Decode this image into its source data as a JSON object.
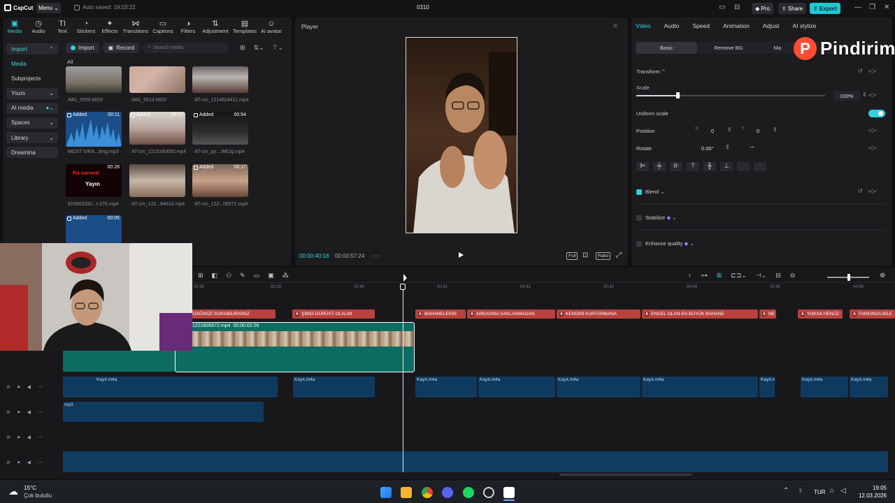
{
  "app": {
    "name": "CapCut",
    "menu_label": "Menu",
    "autosave": "Auto saved: 19:03:22",
    "project_title": "0310",
    "pro_label": "Pro",
    "share_label": "Share",
    "export_label": "Export"
  },
  "toolbar": {
    "items": [
      {
        "label": "Media",
        "icon": "media-icon"
      },
      {
        "label": "Audio",
        "icon": "audio-icon"
      },
      {
        "label": "Text",
        "icon": "text-icon"
      },
      {
        "label": "Stickers",
        "icon": "stickers-icon"
      },
      {
        "label": "Effects",
        "icon": "effects-icon"
      },
      {
        "label": "Transitions",
        "icon": "transitions-icon"
      },
      {
        "label": "Captions",
        "icon": "captions-icon"
      },
      {
        "label": "Filters",
        "icon": "filters-icon"
      },
      {
        "label": "Adjustment",
        "icon": "adjustment-icon"
      },
      {
        "label": "Templates",
        "icon": "templates-icon"
      },
      {
        "label": "AI avatar",
        "icon": "ai-avatar-icon"
      }
    ]
  },
  "sidebar": {
    "items": [
      {
        "label": "Import"
      },
      {
        "label": "Media"
      },
      {
        "label": "Subprojects"
      },
      {
        "label": "Yours"
      },
      {
        "label": "AI media"
      },
      {
        "label": "Spaces"
      },
      {
        "label": "Library"
      },
      {
        "label": "Dreamina"
      }
    ]
  },
  "media": {
    "import_label": "Import",
    "record_label": "Record",
    "search_placeholder": "Search media",
    "section_label": "All",
    "items": [
      {
        "name": "IMG_5550.MOV",
        "tag": "",
        "duration": ""
      },
      {
        "name": "IMG_5513.MOV",
        "tag": "",
        "duration": ""
      },
      {
        "name": "AT-cm_1214624411.mp4",
        "tag": "",
        "duration": ""
      },
      {
        "name": "MOST VIRA...lting.mp3",
        "tag": "Added",
        "duration": "00:11"
      },
      {
        "name": "AT-cm_1213160650.mp4",
        "tag": "Added",
        "duration": "00:17"
      },
      {
        "name": "AT-cm_py....W6Jg.mp4",
        "tag": "Added",
        "duration": "00:54"
      },
      {
        "name": "615663250...t-276.mp4",
        "tag": "",
        "duration": "00:28"
      },
      {
        "name": "AT-cm_122...84610.mp4",
        "tag": "",
        "duration": ""
      },
      {
        "name": "AT-cm_122...06972.mp4",
        "tag": "Added",
        "duration": "00:17"
      },
      {
        "name": "",
        "tag": "Added",
        "duration": "00:05"
      }
    ],
    "thumb_overlay_text": "Yayın",
    "thumb_overlay_text2": "Fix correct!"
  },
  "player": {
    "title": "Player",
    "current_time": "00:00:40:18",
    "total_time": "00:00:57:24",
    "full_label": "Full",
    "ratio_label": "Ratio"
  },
  "inspector": {
    "tabs": [
      "Video",
      "Audio",
      "Speed",
      "Animation",
      "Adjust",
      "AI stylize"
    ],
    "subtabs": [
      "Basic",
      "Remove BG",
      "Ma"
    ],
    "transform_label": "Transform",
    "scale_label": "Scale",
    "scale_value": "100%",
    "scale_level": 0.22,
    "uniform_label": "Uniform scale",
    "position_label": "Position",
    "pos_x_label": "X",
    "pos_x": "0",
    "pos_y_label": "Y",
    "pos_y": "0",
    "rotate_label": "Rotate",
    "rotate_value": "0.00°",
    "blend_label": "Blend",
    "stabilize_label": "Stabilize",
    "enhance_label": "Enhance quality"
  },
  "brand_overlay": {
    "letter": "P",
    "text": "Pindirim"
  },
  "timeline": {
    "ruler": [
      "00:38",
      "00:39",
      "00:40",
      "00:41",
      "00:42",
      "00:43",
      "00:44",
      "00:45",
      "00:46"
    ],
    "subtitles": [
      "EDİĞİNİZİ SORABİLİRSİNİZ",
      "ŞİMDİ DÜRÜST OLALIM",
      "BAHANELERİN",
      "ARKASINA SAKLANMADAN",
      "KENDİNİ KURTARMANA",
      "ENGEL OLAN EN BÜYÜK BAHANE",
      "NE",
      "YOKSA HENÜZ",
      "FARKINDA BİLE"
    ],
    "video_clip_name": "1222806972.mp4",
    "video_clip_duration": "00:00:02:26",
    "audio_clip_name": "Kayıt.m4a",
    "music_clip_name": "mp3"
  },
  "taskbar": {
    "temperature": "15°C",
    "weather": "Çok bulutlu",
    "language": "TUR",
    "time": "19:05",
    "date": "12.03.2026"
  },
  "colors": {
    "accent": "#2fd2dd",
    "export": "#1ec9d4",
    "subtitle_clip": "#b9423e",
    "video_clip": "#0e6d62",
    "audio_clip": "#0f3a60"
  }
}
